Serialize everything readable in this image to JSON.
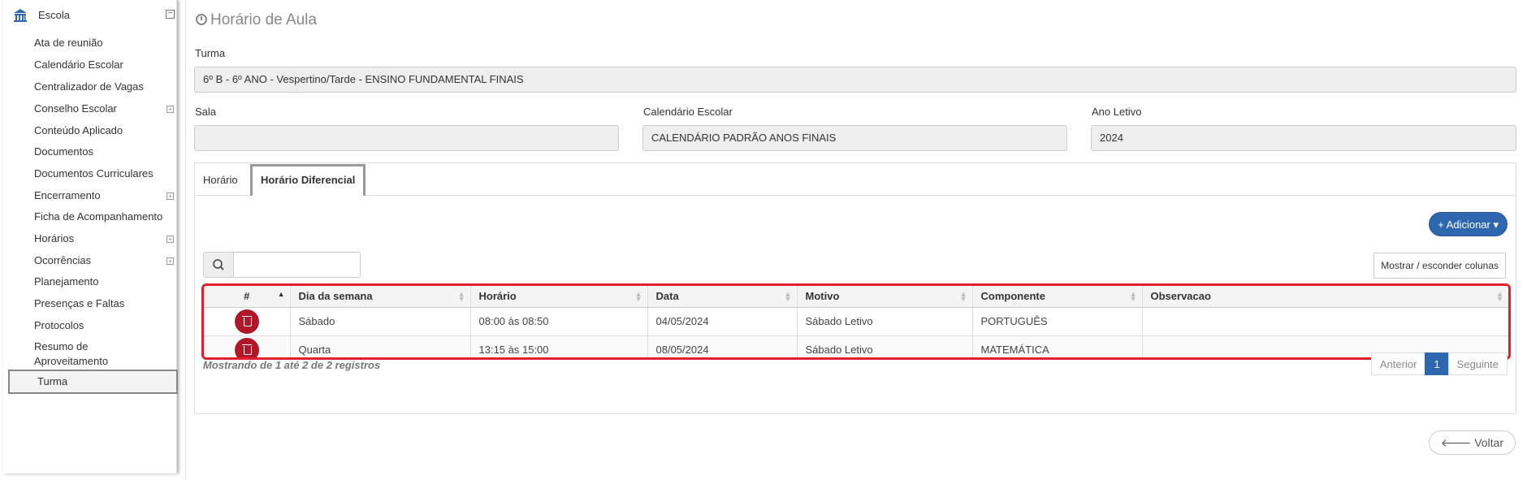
{
  "sidebar": {
    "title": "Escola",
    "items": [
      {
        "label": "Ata de reunião",
        "expandable": false
      },
      {
        "label": "Calendário Escolar",
        "expandable": false
      },
      {
        "label": "Centralizador de Vagas",
        "expandable": false
      },
      {
        "label": "Conselho Escolar",
        "expandable": true
      },
      {
        "label": "Conteúdo Aplicado",
        "expandable": false
      },
      {
        "label": "Documentos",
        "expandable": false
      },
      {
        "label": "Documentos Curriculares",
        "expandable": false
      },
      {
        "label": "Encerramento",
        "expandable": true
      },
      {
        "label": "Ficha de Acompanhamento",
        "expandable": false
      },
      {
        "label": "Horários",
        "expandable": true
      },
      {
        "label": "Ocorrências",
        "expandable": true
      },
      {
        "label": "Planejamento",
        "expandable": false
      },
      {
        "label": "Presenças e Faltas",
        "expandable": false
      },
      {
        "label": "Protocolos",
        "expandable": false
      },
      {
        "label": "Resumo de Aproveitamento",
        "expandable": false
      },
      {
        "label": "Turma",
        "expandable": false,
        "active": true
      }
    ]
  },
  "page": {
    "title": "Horário de Aula"
  },
  "form": {
    "turma_label": "Turma",
    "turma_value": "6º B - 6º ANO - Vespertino/Tarde - ENSINO FUNDAMENTAL FINAIS",
    "sala_label": "Sala",
    "sala_value": "",
    "calendario_label": "Calendário Escolar",
    "calendario_value": "CALENDÁRIO PADRÃO ANOS FINAIS",
    "ano_label": "Ano Letivo",
    "ano_value": "2024"
  },
  "tabs": [
    {
      "label": "Horário",
      "active": false
    },
    {
      "label": "Horário Diferencial",
      "active": true
    }
  ],
  "toolbar": {
    "add_label": "+ Adicionar ▾",
    "columns_label": "Mostrar / esconder colunas",
    "search_value": ""
  },
  "table": {
    "headers": [
      "#",
      "Dia da semana",
      "Horário",
      "Data",
      "Motivo",
      "Componente",
      "Observacao"
    ],
    "rows": [
      {
        "dia": "Sábado",
        "horario": "08:00 às 08:50",
        "data": "04/05/2024",
        "motivo": "Sábado Letivo",
        "componente": "PORTUGUÊS",
        "obs": ""
      },
      {
        "dia": "Quarta",
        "horario": "13:15 às 15:00",
        "data": "08/05/2024",
        "motivo": "Sábado Letivo",
        "componente": "MATEMÁTICA",
        "obs": ""
      }
    ]
  },
  "footer": {
    "info": "Mostrando de 1 até 2 de 2 registros",
    "prev": "Anterior",
    "page": "1",
    "next": "Seguinte",
    "back": "Voltar"
  },
  "colors": {
    "accent": "#2f67ae",
    "danger": "#b0182a",
    "highlight": "#e2202a"
  }
}
